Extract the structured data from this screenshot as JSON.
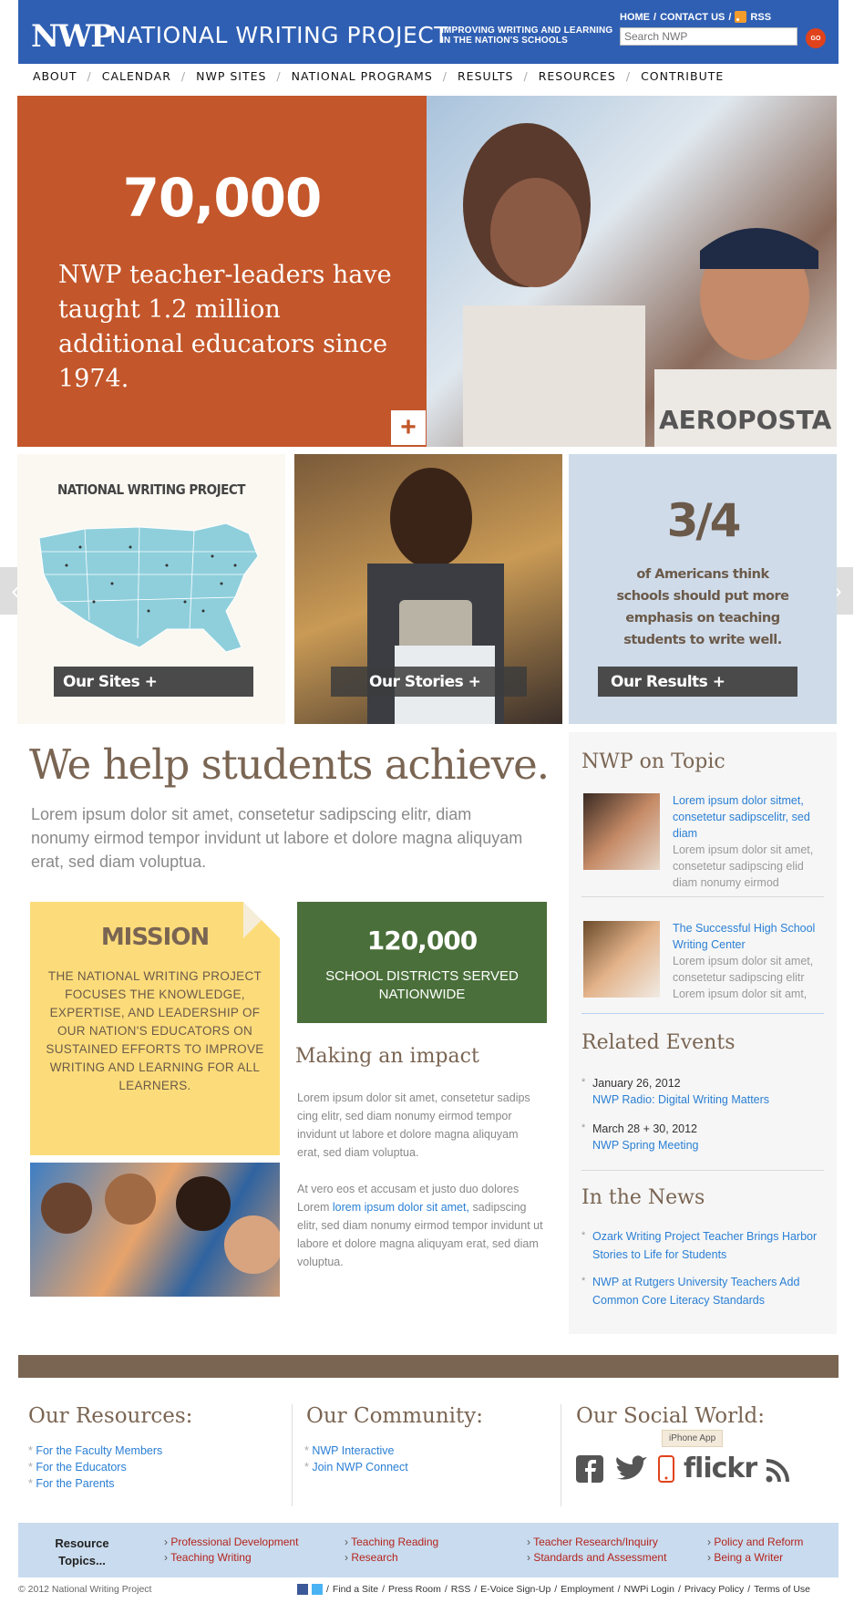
{
  "header": {
    "logo": "NWP",
    "title": "NATIONAL WRITING PROJECT",
    "tagline": "IMPROVING WRITING AND LEARNING IN THE NATION'S SCHOOLS",
    "links": [
      "HOME",
      "CONTACT US",
      "RSS"
    ],
    "search_placeholder": "Search NWP",
    "go_label": "GO"
  },
  "nav": [
    "ABOUT",
    "CALENDAR",
    "NWP SITES",
    "NATIONAL PROGRAMS",
    "RESULTS",
    "RESOURCES",
    "CONTRIBUTE"
  ],
  "hero": {
    "number": "70,000",
    "text": "NWP teacher-leaders have taught 1.2 million additional educators since 1974.",
    "plus": "+"
  },
  "tiles": {
    "map_title": "NATIONAL WRITING PROJECT",
    "sites_btn": "Our Sites +",
    "stories_btn": "Our Stories +",
    "results_stat": "3/4",
    "results_text": "of Americans think schools should put more emphasis on teaching students to write well.",
    "results_btn": "Our Results +"
  },
  "main": {
    "headline": "We help students achieve.",
    "intro": "Lorem ipsum dolor sit amet, consetetur sadipscing elitr, diam nonumy eirmod tempor invidunt ut labore et dolore magna aliquyam erat, sed diam voluptua.",
    "mission_title": "MISSION",
    "mission_text": "THE NATIONAL WRITING PROJECT FOCUSES THE KNOWLEDGE, EXPERTISE, AND LEADERSHIP OF OUR NATION'S EDUCATORS ON SUSTAINED EFFORTS TO IMPROVE WRITING AND LEARNING FOR ALL LEARNERS.",
    "stat_number": "120,000",
    "stat_text": "SCHOOL DISTRICTS SERVED NATIONWIDE",
    "impact_title": "Making an impact",
    "impact_p1": "Lorem ipsum dolor sit amet, consetetur sadips cing elitr, sed diam nonumy eirmod tempor invidunt ut labore et dolore magna aliquyam erat, sed diam voluptua.",
    "impact_p2_a": "At vero eos et accusam et justo duo dolores Lorem ",
    "impact_p2_link": "lorem ipsum dolor sit amet,",
    "impact_p2_b": " sadipscing elitr, sed diam nonumy eirmod tempor invidunt ut labore et dolore magna aliquyam erat, sed diam voluptua."
  },
  "sidebar": {
    "topic_title": "NWP on Topic",
    "topic_items": [
      {
        "link": "Lorem ipsum dolor sitmet, consetetur sadipscelitr, sed diam",
        "desc": "Lorem ipsum dolor sit amet, consetetur sadipscing elid diam nonumy eirmod"
      },
      {
        "link": "The Successful High School Writing Center",
        "desc": "Lorem ipsum dolor sit amet, consetetur sadipscing elitr Lorem ipsum dolor sit amt,"
      }
    ],
    "events_title": "Related Events",
    "events": [
      {
        "date": "January 26, 2012",
        "link": "NWP Radio: Digital Writing Matters"
      },
      {
        "date": "March 28 + 30, 2012",
        "link": "NWP Spring Meeting"
      }
    ],
    "news_title": "In the News",
    "news": [
      "Ozark Writing Project Teacher Brings Harbor Stories to Life for Students",
      "NWP at Rutgers University Teachers Add Common Core Literacy Standards"
    ]
  },
  "footer": {
    "resources_title": "Our Resources:",
    "resources": [
      "For the Faculty Members",
      "For the Educators",
      "For the Parents"
    ],
    "community_title": "Our Community:",
    "community": [
      "NWP Interactive",
      "Join NWP Connect"
    ],
    "social_title": "Our Social World:",
    "tooltip": "iPhone App",
    "flickr": "flickr",
    "resource_topics": "Resource Topics...",
    "topics_col1": [
      "Professional Development",
      "Teaching Writing"
    ],
    "topics_col2": [
      "Teaching Reading",
      "Research"
    ],
    "topics_col3": [
      "Teacher Research/Inquiry",
      "Standards and Assessment"
    ],
    "topics_col4": [
      "Policy and Reform",
      "Being a Writer"
    ],
    "copyright": "© 2012 National Writing Project",
    "bottom_links": [
      "Find a Site",
      "Press Room",
      "RSS",
      "E-Voice Sign-Up",
      "Employment",
      "NWPi Login",
      "Privacy Policy",
      "Terms of Use"
    ]
  },
  "colors": {
    "header_blue": "#2f5fb3",
    "hero_orange": "#c3562a",
    "brown": "#7a6553",
    "green": "#4a6f3a",
    "mission_yellow": "#fcdc7a",
    "link_blue": "#2a7fd4"
  }
}
